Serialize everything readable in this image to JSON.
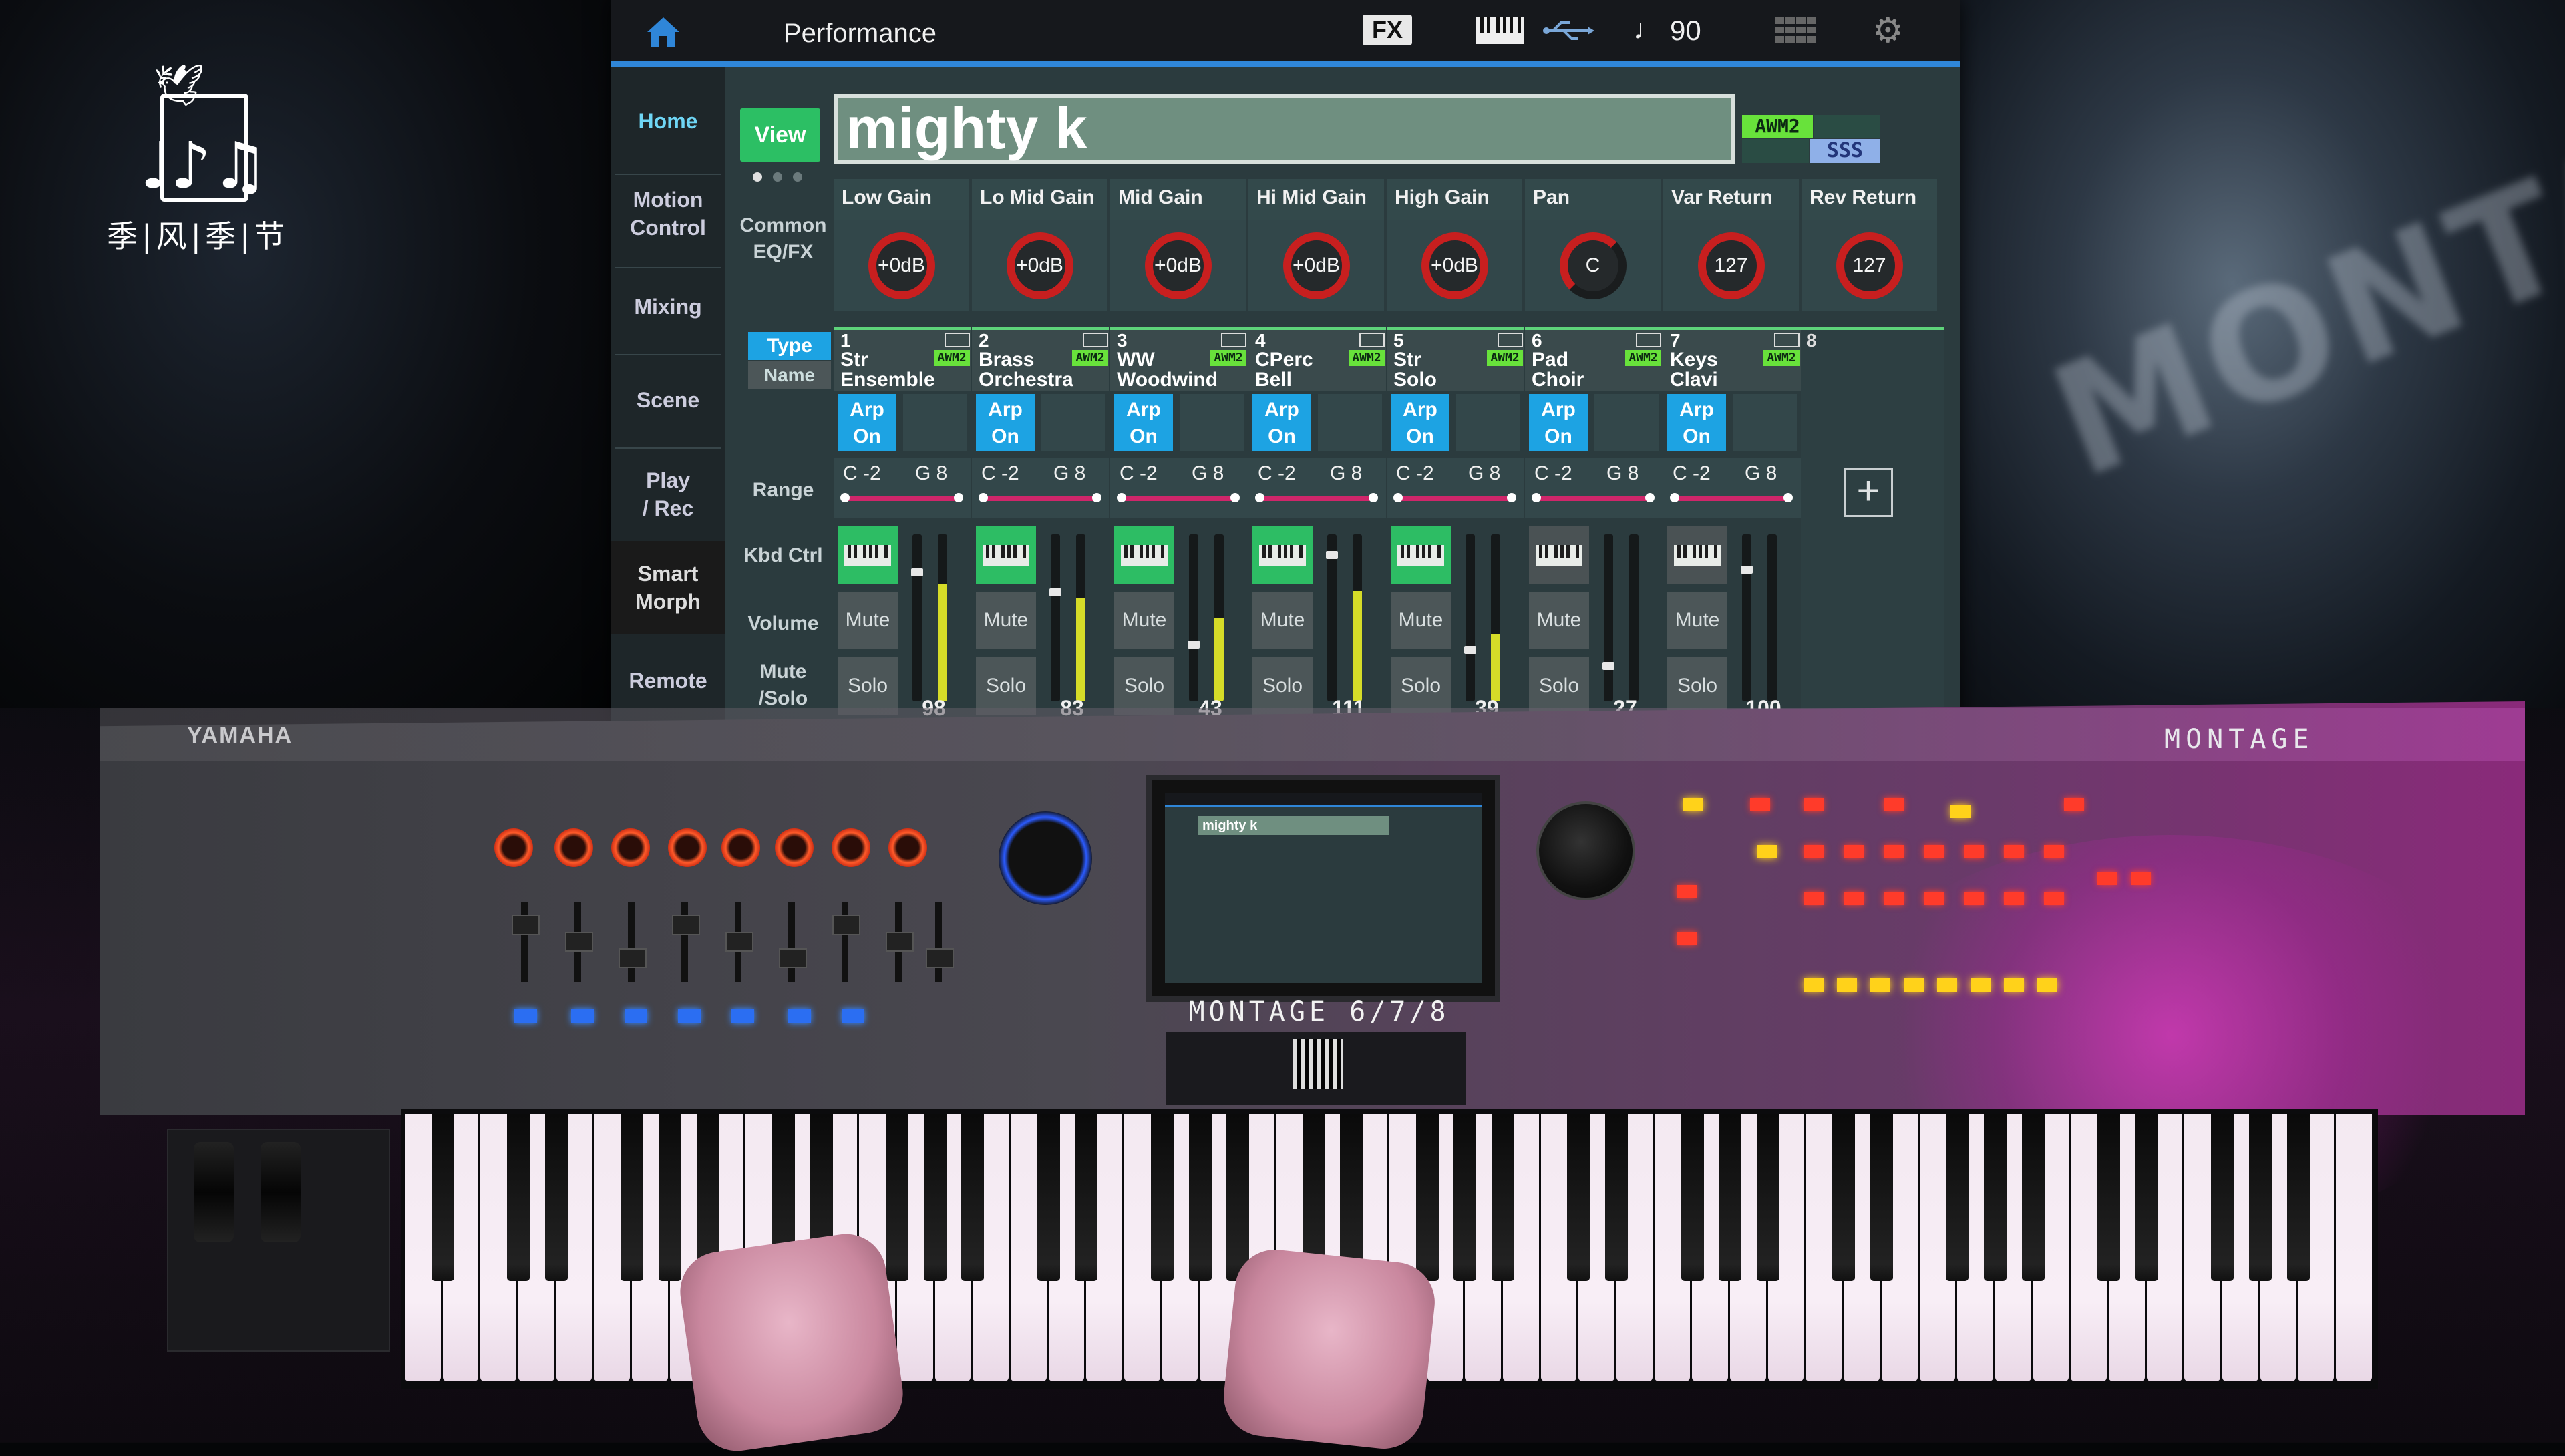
{
  "overlay": {
    "logo_text": "季|风|季|节",
    "logo_notes": "♩♪♫"
  },
  "screen": {
    "title": "Performance",
    "fx_label": "FX",
    "tempo": "90",
    "tempo_icon": "♩",
    "sidebar": [
      {
        "label": "Home",
        "active": true
      },
      {
        "label": "Motion\nControl"
      },
      {
        "label": "Mixing"
      },
      {
        "label": "Scene"
      },
      {
        "label": "Play\n/ Rec"
      },
      {
        "label": "Smart\nMorph"
      },
      {
        "label": "Remote"
      }
    ],
    "view_label": "View",
    "performance_name": "mighty k",
    "awm_badge": "AWM2",
    "sss_badge": "SSS",
    "row_labels": {
      "common": "Common\nEQ/FX",
      "range": "Range",
      "kbd_ctrl": "Kbd Ctrl",
      "volume": "Volume",
      "mute_solo": "Mute\n/Solo"
    },
    "type_tab": "Type",
    "name_tab": "Name",
    "eq": [
      {
        "label": "Low Gain",
        "value": "+0dB"
      },
      {
        "label": "Lo Mid Gain",
        "value": "+0dB"
      },
      {
        "label": "Mid Gain",
        "value": "+0dB"
      },
      {
        "label": "Hi Mid Gain",
        "value": "+0dB"
      },
      {
        "label": "High Gain",
        "value": "+0dB"
      },
      {
        "label": "Pan",
        "value": "C"
      },
      {
        "label": "Var Return",
        "value": "127"
      },
      {
        "label": "Rev Return",
        "value": "127"
      }
    ],
    "parts": [
      {
        "num": "1",
        "name": "Str\nEnsemble",
        "engine": "AWM2",
        "arp": "Arp\nOn",
        "range_lo": "C -2",
        "range_hi": "G 8",
        "kbd_on": true,
        "mute": "Mute",
        "solo": "Solo",
        "volume": "98",
        "level": 0.7
      },
      {
        "num": "2",
        "name": "Brass\nOrchestra",
        "engine": "AWM2",
        "arp": "Arp\nOn",
        "range_lo": "C -2",
        "range_hi": "G 8",
        "kbd_on": true,
        "mute": "Mute",
        "solo": "Solo",
        "volume": "83",
        "level": 0.62
      },
      {
        "num": "3",
        "name": "WW\nWoodwind",
        "engine": "AWM2",
        "arp": "Arp\nOn",
        "range_lo": "C -2",
        "range_hi": "G 8",
        "kbd_on": true,
        "mute": "Mute",
        "solo": "Solo",
        "volume": "43",
        "level": 0.5
      },
      {
        "num": "4",
        "name": "CPerc\nBell",
        "engine": "AWM2",
        "arp": "Arp\nOn",
        "range_lo": "C -2",
        "range_hi": "G 8",
        "kbd_on": true,
        "mute": "Mute",
        "solo": "Solo",
        "volume": "111",
        "level": 0.66
      },
      {
        "num": "5",
        "name": "Str\nSolo",
        "engine": "AWM2",
        "arp": "Arp\nOn",
        "range_lo": "C -2",
        "range_hi": "G 8",
        "kbd_on": true,
        "mute": "Mute",
        "solo": "Solo",
        "volume": "39",
        "level": 0.4
      },
      {
        "num": "6",
        "name": "Pad\nChoir",
        "engine": "AWM2",
        "arp": "Arp\nOn",
        "range_lo": "C -2",
        "range_hi": "G 8",
        "kbd_on": false,
        "mute": "Mute",
        "solo": "Solo",
        "volume": "27",
        "level": 0.0
      },
      {
        "num": "7",
        "name": "Keys\nClavi",
        "engine": "AWM2",
        "arp": "Arp\nOn",
        "range_lo": "C -2",
        "range_hi": "G 8",
        "kbd_on": false,
        "mute": "Mute",
        "solo": "Solo",
        "volume": "100",
        "level": 0.0
      }
    ],
    "part8_num": "8",
    "add_label": "+"
  },
  "hardware": {
    "brand": "YAMAHA",
    "model_logo": "MONTAGE",
    "model_plate": "MONTAGE 6/7/8",
    "mini_name": "mighty k"
  },
  "colors": {
    "accent_blue": "#1da3e3",
    "active_green": "#2dbd64",
    "knob_red": "#c81f1f",
    "awm_green": "#68e23b"
  }
}
